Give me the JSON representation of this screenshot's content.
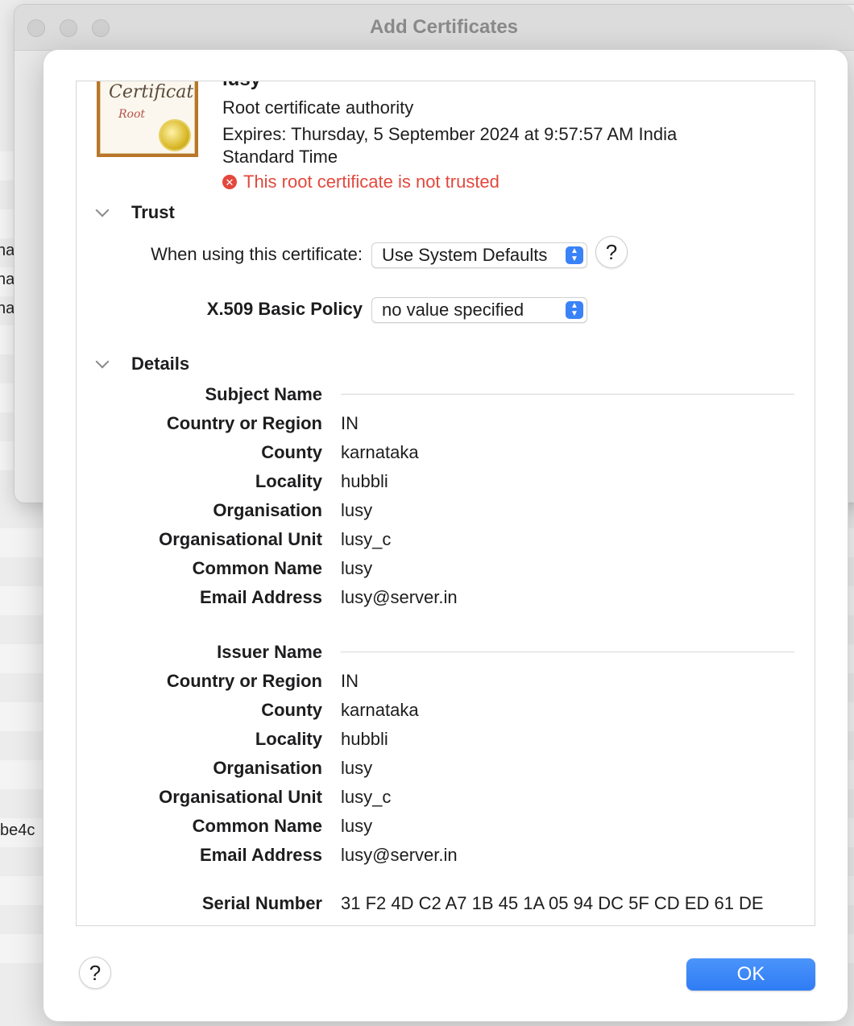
{
  "window": {
    "title": "Add Certificates"
  },
  "background_fragments": [
    "nai",
    "nai",
    "na",
    "be4c"
  ],
  "certificate": {
    "image_word": "Certificate",
    "image_sub": "Root",
    "name": "lusy",
    "type": "Root certificate authority",
    "expires": "Expires: Thursday, 5 September 2024 at 9:57:57 AM India Standard Time",
    "status": "This root certificate is not trusted"
  },
  "trust": {
    "heading": "Trust",
    "when_using_label": "When using this certificate:",
    "when_using_value": "Use System Defaults",
    "policy_label": "X.509 Basic Policy",
    "policy_value": "no value specified",
    "help": "?"
  },
  "details": {
    "heading": "Details",
    "subject": {
      "title": "Subject Name",
      "rows": [
        {
          "key": "Country or Region",
          "value": "IN"
        },
        {
          "key": "County",
          "value": "karnataka"
        },
        {
          "key": "Locality",
          "value": "hubbli"
        },
        {
          "key": "Organisation",
          "value": "lusy"
        },
        {
          "key": "Organisational Unit",
          "value": "lusy_c"
        },
        {
          "key": "Common Name",
          "value": "lusy"
        },
        {
          "key": "Email Address",
          "value": "lusy@server.in"
        }
      ]
    },
    "issuer": {
      "title": "Issuer Name",
      "rows": [
        {
          "key": "Country or Region",
          "value": "IN"
        },
        {
          "key": "County",
          "value": "karnataka"
        },
        {
          "key": "Locality",
          "value": "hubbli"
        },
        {
          "key": "Organisation",
          "value": "lusy"
        },
        {
          "key": "Organisational Unit",
          "value": "lusy_c"
        },
        {
          "key": "Common Name",
          "value": "lusy"
        },
        {
          "key": "Email Address",
          "value": "lusy@server.in"
        }
      ]
    },
    "serial": {
      "key": "Serial Number",
      "value": "31 F2 4D C2 A7 1B 45 1A 05 94 DC 5F CD ED 61 DE"
    }
  },
  "footer": {
    "help": "?",
    "ok_label": "OK"
  }
}
